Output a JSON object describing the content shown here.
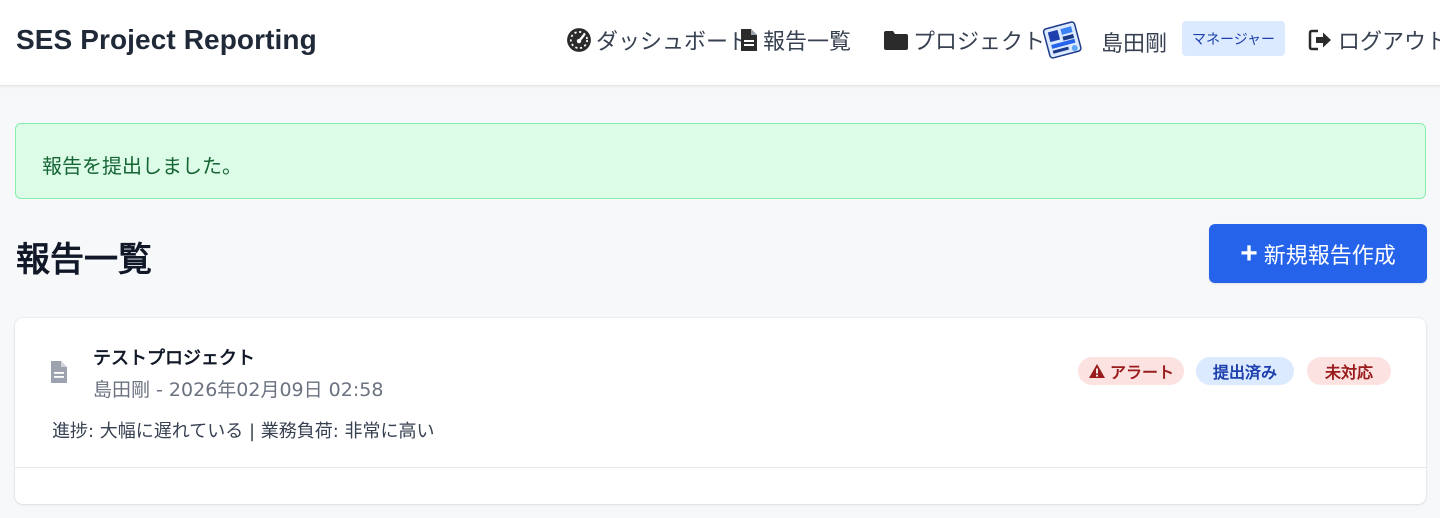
{
  "app": {
    "title": "SES Project Reporting"
  },
  "nav": {
    "dashboard": "ダッシュボード",
    "reports": "報告一覧",
    "projects": "プロジェクト",
    "logout": "ログアウト"
  },
  "user": {
    "name": "島田剛",
    "role": "マネージャー"
  },
  "alert": {
    "message": "報告を提出しました。"
  },
  "page": {
    "title": "報告一覧",
    "new_report_button": "新規報告作成"
  },
  "reports": [
    {
      "project": "テストプロジェクト",
      "meta": "島田剛 - 2026年02月09日 02:58",
      "summary": "進捗: 大幅に遅れている | 業務負荷: 非常に高い",
      "badges": {
        "alert": "アラート",
        "status": "提出済み",
        "response": "未対応"
      }
    }
  ],
  "colors": {
    "primary": "#2563eb",
    "success_bg": "#dcfce7",
    "success_text": "#166534",
    "danger_bg": "#fde2e2",
    "danger_text": "#991b1b",
    "info_bg": "#dbeafe",
    "info_text": "#1e40af"
  },
  "icons": {
    "dashboard": "gauge-icon",
    "reports": "file-icon",
    "projects": "folder-icon",
    "logout": "sign-out-icon",
    "alert_badge": "warning-triangle-icon",
    "report_item": "document-icon"
  }
}
